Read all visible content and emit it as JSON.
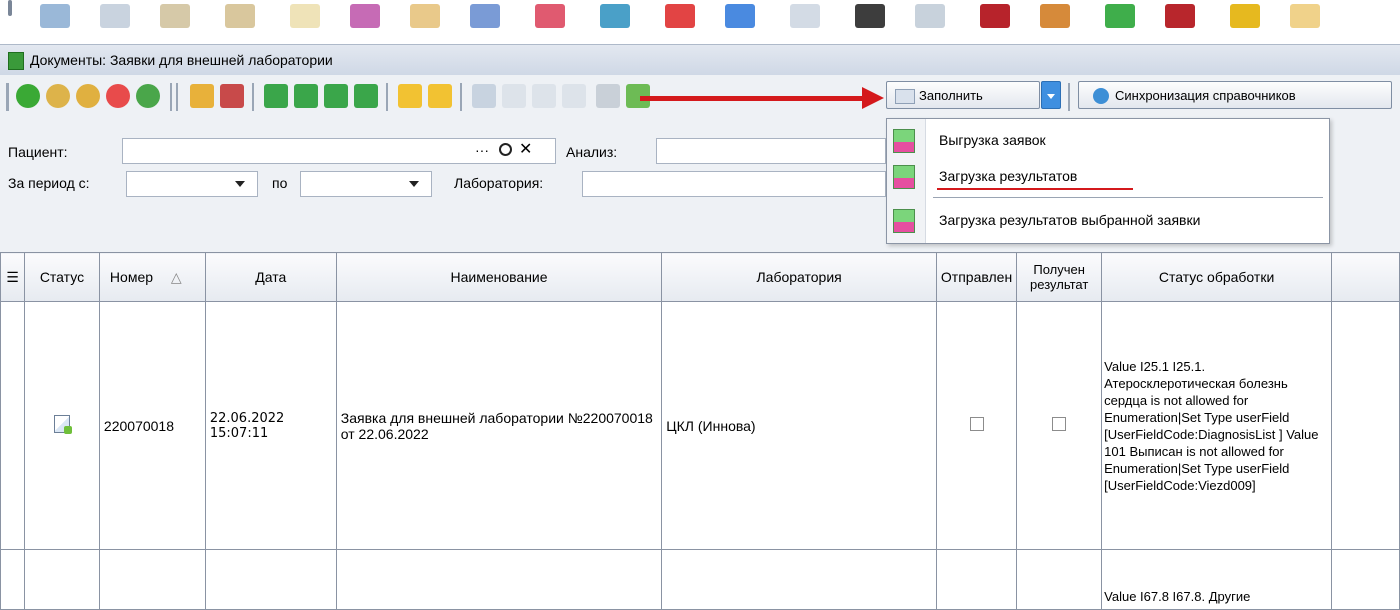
{
  "window": {
    "title": "Документы: Заявки для внешней лаборатории"
  },
  "toolbar": {
    "fill_label": "Заполнить",
    "sync_label": "Синхронизация справочников"
  },
  "filters": {
    "patient_label": "Пациент:",
    "patient_value": "",
    "analysis_label": "Анализ:",
    "period_from_label": "За период с:",
    "period_to_label": "по",
    "lab_label": "Лаборатория:",
    "dots": "···"
  },
  "menu": {
    "items": [
      {
        "label": "Выгрузка заявок"
      },
      {
        "label": "Загрузка результатов"
      },
      {
        "label": "Загрузка результатов выбранной заявки"
      }
    ]
  },
  "grid": {
    "columns": [
      "Статус",
      "Номер",
      "Дата",
      "Наименование",
      "Лаборатория",
      "Отправлен",
      "Получен результат",
      "Статус обработки"
    ],
    "rows": [
      {
        "number": "220070018",
        "date": "22.06.2022 15:07:11",
        "name": "Заявка для внешней лаборатории №220070018 от 22.06.2022",
        "lab": "ЦКЛ (Иннова)",
        "sent": false,
        "received": false,
        "processing_status": "Value I25.1 I25.1. Атеросклеротическая болезнь сердца is not allowed for Enumeration|Set Type userField [UserFieldCode:DiagnosisList ] Value 101 Выписан is not allowed for Enumeration|Set Type userField [UserFieldCode:Viezd009]"
      },
      {
        "number": "",
        "date": "",
        "name": "",
        "lab": "",
        "sent": false,
        "received": false,
        "processing_status": "Value I67.8 I67.8. Другие"
      }
    ]
  },
  "colors": {
    "accent_red": "#d4191c",
    "panel_bg": "#eef1f5"
  }
}
